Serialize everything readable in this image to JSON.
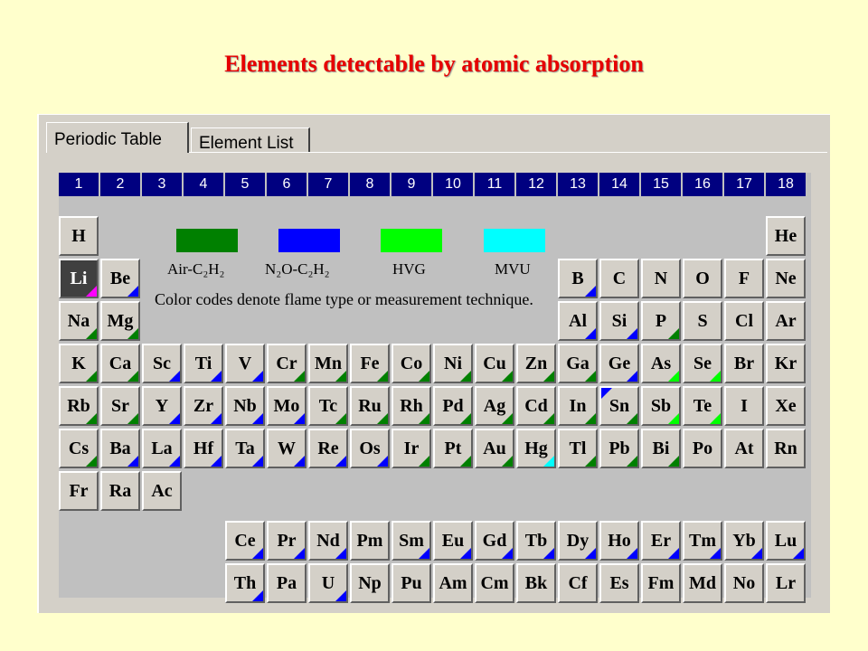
{
  "page": {
    "title": "Elements detectable by atomic absorption"
  },
  "tabs": [
    {
      "label": "Periodic Table",
      "active": true
    },
    {
      "label": "Element List",
      "active": false
    }
  ],
  "groups": [
    "1",
    "2",
    "3",
    "4",
    "5",
    "6",
    "7",
    "8",
    "9",
    "10",
    "11",
    "12",
    "13",
    "14",
    "15",
    "16",
    "17",
    "18"
  ],
  "legend": {
    "items": [
      {
        "label": "Air-C₂H₂",
        "color": "#008000"
      },
      {
        "label": "N₂O-C₂H₂",
        "color": "#0000ff"
      },
      {
        "label": "HVG",
        "color": "#00ff00"
      },
      {
        "label": "MVU",
        "color": "#00ffff"
      }
    ],
    "note": "Color codes denote flame type or measurement technique."
  },
  "colors": {
    "air": "#008000",
    "n2o": "#0000ff",
    "hvg": "#00ff00",
    "mvu": "#00ffff",
    "li": "#ff00ff",
    "header_bg": "#000080"
  },
  "elements": [
    {
      "s": "H",
      "g": 1,
      "p": 1,
      "c": []
    },
    {
      "s": "He",
      "g": 18,
      "p": 1,
      "c": []
    },
    {
      "s": "Li",
      "g": 1,
      "p": 2,
      "c": [
        "li"
      ],
      "sel": true
    },
    {
      "s": "Be",
      "g": 2,
      "p": 2,
      "c": [
        "n2o"
      ]
    },
    {
      "s": "B",
      "g": 13,
      "p": 2,
      "c": [
        "n2o"
      ]
    },
    {
      "s": "C",
      "g": 14,
      "p": 2,
      "c": []
    },
    {
      "s": "N",
      "g": 15,
      "p": 2,
      "c": []
    },
    {
      "s": "O",
      "g": 16,
      "p": 2,
      "c": []
    },
    {
      "s": "F",
      "g": 17,
      "p": 2,
      "c": []
    },
    {
      "s": "Ne",
      "g": 18,
      "p": 2,
      "c": []
    },
    {
      "s": "Na",
      "g": 1,
      "p": 3,
      "c": [
        "air"
      ]
    },
    {
      "s": "Mg",
      "g": 2,
      "p": 3,
      "c": [
        "air"
      ]
    },
    {
      "s": "Al",
      "g": 13,
      "p": 3,
      "c": [
        "n2o"
      ]
    },
    {
      "s": "Si",
      "g": 14,
      "p": 3,
      "c": [
        "n2o"
      ]
    },
    {
      "s": "P",
      "g": 15,
      "p": 3,
      "c": [
        "air"
      ]
    },
    {
      "s": "S",
      "g": 16,
      "p": 3,
      "c": []
    },
    {
      "s": "Cl",
      "g": 17,
      "p": 3,
      "c": []
    },
    {
      "s": "Ar",
      "g": 18,
      "p": 3,
      "c": []
    },
    {
      "s": "K",
      "g": 1,
      "p": 4,
      "c": [
        "air"
      ]
    },
    {
      "s": "Ca",
      "g": 2,
      "p": 4,
      "c": [
        "air"
      ]
    },
    {
      "s": "Sc",
      "g": 3,
      "p": 4,
      "c": [
        "n2o"
      ]
    },
    {
      "s": "Ti",
      "g": 4,
      "p": 4,
      "c": [
        "n2o"
      ]
    },
    {
      "s": "V",
      "g": 5,
      "p": 4,
      "c": [
        "n2o"
      ]
    },
    {
      "s": "Cr",
      "g": 6,
      "p": 4,
      "c": [
        "air"
      ]
    },
    {
      "s": "Mn",
      "g": 7,
      "p": 4,
      "c": [
        "air"
      ]
    },
    {
      "s": "Fe",
      "g": 8,
      "p": 4,
      "c": [
        "air"
      ]
    },
    {
      "s": "Co",
      "g": 9,
      "p": 4,
      "c": [
        "air"
      ]
    },
    {
      "s": "Ni",
      "g": 10,
      "p": 4,
      "c": [
        "air"
      ]
    },
    {
      "s": "Cu",
      "g": 11,
      "p": 4,
      "c": [
        "air"
      ]
    },
    {
      "s": "Zn",
      "g": 12,
      "p": 4,
      "c": [
        "air"
      ]
    },
    {
      "s": "Ga",
      "g": 13,
      "p": 4,
      "c": [
        "air"
      ]
    },
    {
      "s": "Ge",
      "g": 14,
      "p": 4,
      "c": [
        "n2o"
      ]
    },
    {
      "s": "As",
      "g": 15,
      "p": 4,
      "c": [
        "hvg"
      ]
    },
    {
      "s": "Se",
      "g": 16,
      "p": 4,
      "c": [
        "hvg"
      ]
    },
    {
      "s": "Br",
      "g": 17,
      "p": 4,
      "c": []
    },
    {
      "s": "Kr",
      "g": 18,
      "p": 4,
      "c": []
    },
    {
      "s": "Rb",
      "g": 1,
      "p": 5,
      "c": [
        "air"
      ]
    },
    {
      "s": "Sr",
      "g": 2,
      "p": 5,
      "c": [
        "air"
      ]
    },
    {
      "s": "Y",
      "g": 3,
      "p": 5,
      "c": [
        "n2o"
      ]
    },
    {
      "s": "Zr",
      "g": 4,
      "p": 5,
      "c": [
        "n2o"
      ]
    },
    {
      "s": "Nb",
      "g": 5,
      "p": 5,
      "c": [
        "n2o"
      ]
    },
    {
      "s": "Mo",
      "g": 6,
      "p": 5,
      "c": [
        "n2o"
      ]
    },
    {
      "s": "Tc",
      "g": 7,
      "p": 5,
      "c": [
        "air"
      ]
    },
    {
      "s": "Ru",
      "g": 8,
      "p": 5,
      "c": [
        "air"
      ]
    },
    {
      "s": "Rh",
      "g": 9,
      "p": 5,
      "c": [
        "air"
      ]
    },
    {
      "s": "Pd",
      "g": 10,
      "p": 5,
      "c": [
        "air"
      ]
    },
    {
      "s": "Ag",
      "g": 11,
      "p": 5,
      "c": [
        "air"
      ]
    },
    {
      "s": "Cd",
      "g": 12,
      "p": 5,
      "c": [
        "air"
      ]
    },
    {
      "s": "In",
      "g": 13,
      "p": 5,
      "c": [
        "air"
      ]
    },
    {
      "s": "Sn",
      "g": 14,
      "p": 5,
      "c": [
        "air",
        "n2o_top"
      ]
    },
    {
      "s": "Sb",
      "g": 15,
      "p": 5,
      "c": [
        "hvg"
      ]
    },
    {
      "s": "Te",
      "g": 16,
      "p": 5,
      "c": [
        "hvg"
      ]
    },
    {
      "s": "I",
      "g": 17,
      "p": 5,
      "c": []
    },
    {
      "s": "Xe",
      "g": 18,
      "p": 5,
      "c": []
    },
    {
      "s": "Cs",
      "g": 1,
      "p": 6,
      "c": [
        "air"
      ]
    },
    {
      "s": "Ba",
      "g": 2,
      "p": 6,
      "c": [
        "n2o"
      ]
    },
    {
      "s": "La",
      "g": 3,
      "p": 6,
      "c": [
        "n2o"
      ]
    },
    {
      "s": "Hf",
      "g": 4,
      "p": 6,
      "c": [
        "n2o"
      ]
    },
    {
      "s": "Ta",
      "g": 5,
      "p": 6,
      "c": [
        "n2o"
      ]
    },
    {
      "s": "W",
      "g": 6,
      "p": 6,
      "c": [
        "n2o"
      ]
    },
    {
      "s": "Re",
      "g": 7,
      "p": 6,
      "c": [
        "n2o"
      ]
    },
    {
      "s": "Os",
      "g": 8,
      "p": 6,
      "c": [
        "n2o"
      ]
    },
    {
      "s": "Ir",
      "g": 9,
      "p": 6,
      "c": [
        "air"
      ]
    },
    {
      "s": "Pt",
      "g": 10,
      "p": 6,
      "c": [
        "air"
      ]
    },
    {
      "s": "Au",
      "g": 11,
      "p": 6,
      "c": [
        "air"
      ]
    },
    {
      "s": "Hg",
      "g": 12,
      "p": 6,
      "c": [
        "mvu"
      ]
    },
    {
      "s": "Tl",
      "g": 13,
      "p": 6,
      "c": [
        "air"
      ]
    },
    {
      "s": "Pb",
      "g": 14,
      "p": 6,
      "c": [
        "air"
      ]
    },
    {
      "s": "Bi",
      "g": 15,
      "p": 6,
      "c": [
        "air"
      ]
    },
    {
      "s": "Po",
      "g": 16,
      "p": 6,
      "c": []
    },
    {
      "s": "At",
      "g": 17,
      "p": 6,
      "c": []
    },
    {
      "s": "Rn",
      "g": 18,
      "p": 6,
      "c": []
    },
    {
      "s": "Fr",
      "g": 1,
      "p": 7,
      "c": []
    },
    {
      "s": "Ra",
      "g": 2,
      "p": 7,
      "c": []
    },
    {
      "s": "Ac",
      "g": 3,
      "p": 7,
      "c": []
    },
    {
      "s": "Ce",
      "g": 5,
      "p": 8,
      "c": [
        "n2o"
      ]
    },
    {
      "s": "Pr",
      "g": 6,
      "p": 8,
      "c": [
        "n2o"
      ]
    },
    {
      "s": "Nd",
      "g": 7,
      "p": 8,
      "c": [
        "n2o"
      ]
    },
    {
      "s": "Pm",
      "g": 8,
      "p": 8,
      "c": []
    },
    {
      "s": "Sm",
      "g": 9,
      "p": 8,
      "c": [
        "n2o"
      ]
    },
    {
      "s": "Eu",
      "g": 10,
      "p": 8,
      "c": [
        "n2o"
      ]
    },
    {
      "s": "Gd",
      "g": 11,
      "p": 8,
      "c": [
        "n2o"
      ]
    },
    {
      "s": "Tb",
      "g": 12,
      "p": 8,
      "c": [
        "n2o"
      ]
    },
    {
      "s": "Dy",
      "g": 13,
      "p": 8,
      "c": [
        "n2o"
      ]
    },
    {
      "s": "Ho",
      "g": 14,
      "p": 8,
      "c": [
        "n2o"
      ]
    },
    {
      "s": "Er",
      "g": 15,
      "p": 8,
      "c": [
        "n2o"
      ]
    },
    {
      "s": "Tm",
      "g": 16,
      "p": 8,
      "c": [
        "n2o"
      ]
    },
    {
      "s": "Yb",
      "g": 17,
      "p": 8,
      "c": [
        "n2o"
      ]
    },
    {
      "s": "Lu",
      "g": 18,
      "p": 8,
      "c": [
        "n2o"
      ]
    },
    {
      "s": "Th",
      "g": 5,
      "p": 9,
      "c": [
        "n2o"
      ]
    },
    {
      "s": "Pa",
      "g": 6,
      "p": 9,
      "c": []
    },
    {
      "s": "U",
      "g": 7,
      "p": 9,
      "c": [
        "n2o"
      ]
    },
    {
      "s": "Np",
      "g": 8,
      "p": 9,
      "c": []
    },
    {
      "s": "Pu",
      "g": 9,
      "p": 9,
      "c": []
    },
    {
      "s": "Am",
      "g": 10,
      "p": 9,
      "c": []
    },
    {
      "s": "Cm",
      "g": 11,
      "p": 9,
      "c": []
    },
    {
      "s": "Bk",
      "g": 12,
      "p": 9,
      "c": []
    },
    {
      "s": "Cf",
      "g": 13,
      "p": 9,
      "c": []
    },
    {
      "s": "Es",
      "g": 14,
      "p": 9,
      "c": []
    },
    {
      "s": "Fm",
      "g": 15,
      "p": 9,
      "c": []
    },
    {
      "s": "Md",
      "g": 16,
      "p": 9,
      "c": []
    },
    {
      "s": "No",
      "g": 17,
      "p": 9,
      "c": []
    },
    {
      "s": "Lr",
      "g": 18,
      "p": 9,
      "c": []
    }
  ]
}
